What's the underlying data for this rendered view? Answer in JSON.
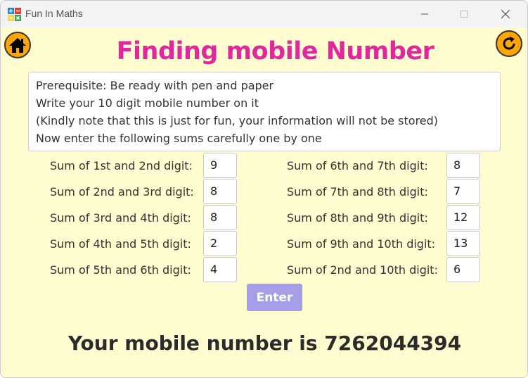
{
  "window": {
    "title": "Fun In Maths",
    "icon": "math-operators-icon",
    "controls": [
      "minimize-icon",
      "maximize-icon",
      "close-icon"
    ]
  },
  "header": {
    "title": "Finding mobile Number",
    "home_icon": "home-icon",
    "refresh_icon": "refresh-icon"
  },
  "instructions": [
    "Prerequisite: Be ready with pen and paper",
    "Write your 10 digit mobile number on it",
    "(Kindly note that this is just for fun, your information will not be stored)",
    "Now enter the following sums carefully one by one"
  ],
  "sums_left": [
    {
      "label": "Sum of 1st and 2nd digit:",
      "value": "9"
    },
    {
      "label": "Sum of 2nd and 3rd digit:",
      "value": "8"
    },
    {
      "label": "Sum of 3rd and 4th digit:",
      "value": "8"
    },
    {
      "label": "Sum of 4th and 5th digit:",
      "value": "2"
    },
    {
      "label": "Sum of 5th and 6th digit:",
      "value": "4"
    }
  ],
  "sums_right": [
    {
      "label": "Sum of 6th and 7th digit:",
      "value": "8"
    },
    {
      "label": "Sum of 7th and 8th digit:",
      "value": "7"
    },
    {
      "label": "Sum of 8th and 9th digit:",
      "value": "12"
    },
    {
      "label": "Sum of 9th and 10th digit:",
      "value": "13"
    },
    {
      "label": "Sum of 2nd and 10th digit:",
      "value": "6"
    }
  ],
  "enter_label": "Enter",
  "result_text": "Your mobile number is 7262044394",
  "colors": {
    "background": "#fffdd0",
    "title": "#e0279e",
    "button_accent": "#ffa500",
    "enter_button": "#a59ee8"
  }
}
